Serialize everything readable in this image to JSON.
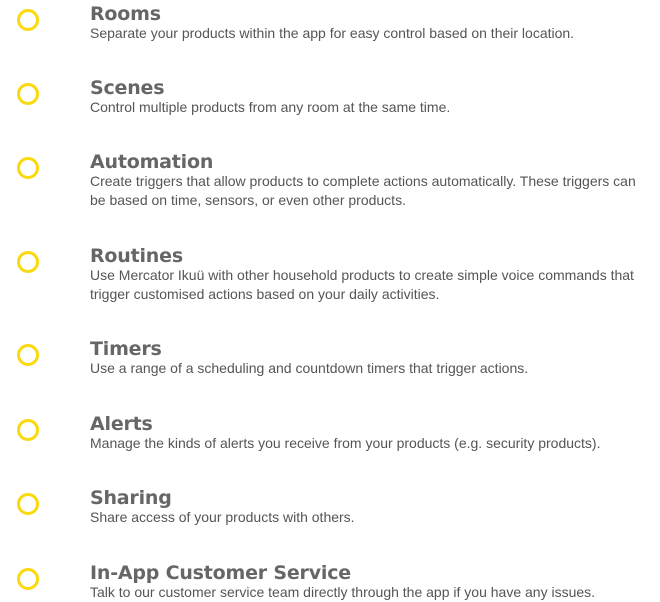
{
  "accent_color": "#fbd90b",
  "features": [
    {
      "icon": "circle-outline-icon",
      "title": "Rooms",
      "description": "Separate your products within the app for easy control based on their location."
    },
    {
      "icon": "circle-outline-icon",
      "title": "Scenes",
      "description": "Control multiple products from any room at the same time."
    },
    {
      "icon": "circle-outline-icon",
      "title": "Automation",
      "description": "Create triggers that allow products to complete actions automatically. These triggers can be based on time, sensors, or even other products."
    },
    {
      "icon": "circle-outline-icon",
      "title": "Routines",
      "description": "Use Mercator Ikuü with other household products to create simple voice commands that trigger customised actions based on your daily activities."
    },
    {
      "icon": "circle-outline-icon",
      "title": "Timers",
      "description": "Use a range of a scheduling and countdown timers that trigger actions."
    },
    {
      "icon": "circle-outline-icon",
      "title": "Alerts",
      "description": "Manage the kinds of alerts you receive from your products (e.g. security products)."
    },
    {
      "icon": "circle-outline-icon",
      "title": "Sharing",
      "description": "Share access of your products with others."
    },
    {
      "icon": "circle-outline-icon",
      "title": "In-App Customer Service",
      "description": "Talk to our customer service team directly through the app if you have any issues."
    }
  ]
}
